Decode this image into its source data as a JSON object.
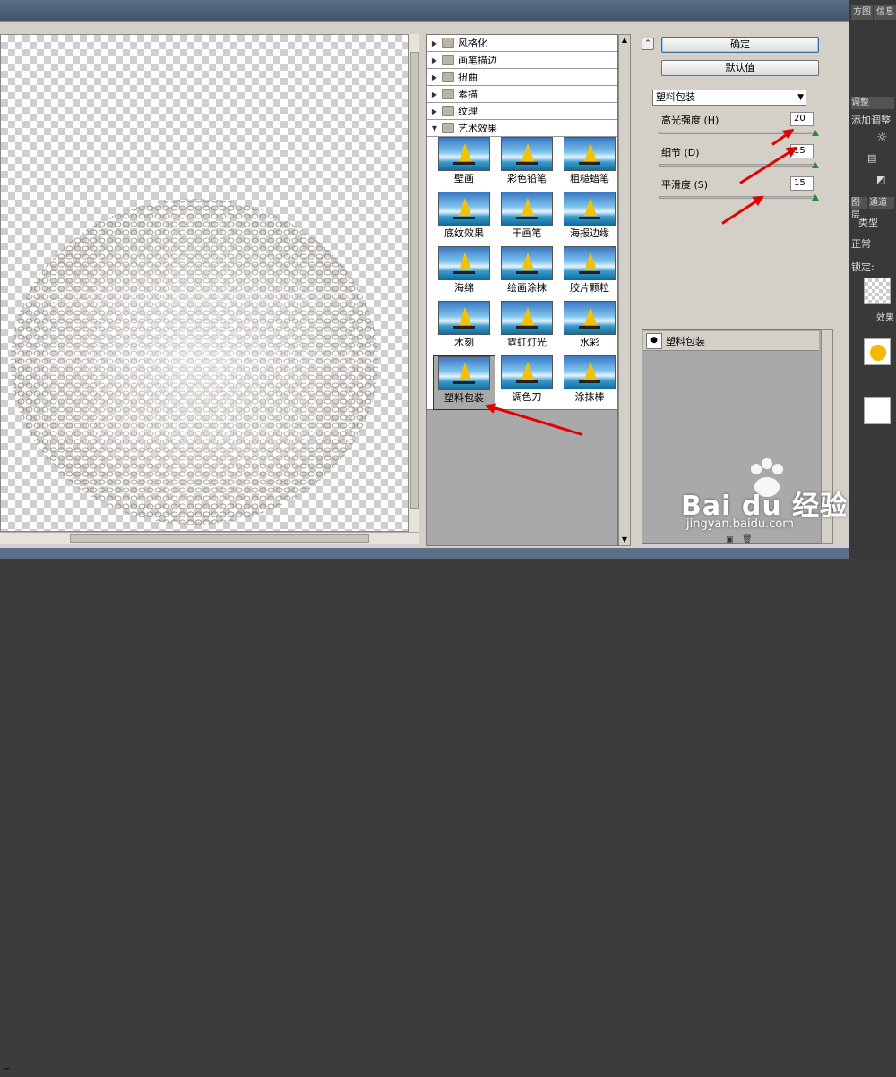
{
  "filter_categories": [
    {
      "label": "风格化",
      "expanded": false
    },
    {
      "label": "画笔描边",
      "expanded": false
    },
    {
      "label": "扭曲",
      "expanded": false
    },
    {
      "label": "素描",
      "expanded": false
    },
    {
      "label": "纹理",
      "expanded": false
    },
    {
      "label": "艺术效果",
      "expanded": true
    }
  ],
  "artistic_filters": [
    "壁画",
    "彩色铅笔",
    "粗糙蜡笔",
    "底纹效果",
    "干画笔",
    "海报边缘",
    "海绵",
    "绘画涂抹",
    "胶片颗粒",
    "木刻",
    "霓虹灯光",
    "水彩",
    "塑料包装",
    "调色刀",
    "涂抹棒"
  ],
  "selected_filter": "塑料包装",
  "buttons": {
    "ok": "确定",
    "default": "默认值",
    "collapse": "⌃"
  },
  "settings": {
    "filter_select": "塑料包装",
    "params": [
      {
        "label": "高光强度 (H)",
        "value": "20"
      },
      {
        "label": "细节 (D)",
        "value": "15"
      },
      {
        "label": "平滑度 (S)",
        "value": "15"
      }
    ]
  },
  "effect_layers": [
    {
      "label": "塑料包装"
    }
  ],
  "ps_panel": {
    "top_tabs": [
      "方图",
      "信息"
    ],
    "adjust_label": "调整",
    "adjust_title": "添加调整",
    "layers_tabs": [
      "图层",
      "通道"
    ],
    "kind_label": "类型",
    "blend_label": "正常",
    "lock_label": "锁定:",
    "layer_label": "效果"
  },
  "zoom_minus": "−",
  "watermark": {
    "brand": "Bai du 经验",
    "url": "jingyan.baidu.com"
  },
  "colors": {
    "arrow": "#e00000",
    "slider_knob": "#2e8a2e",
    "ok_border": "#3a6ea5"
  }
}
